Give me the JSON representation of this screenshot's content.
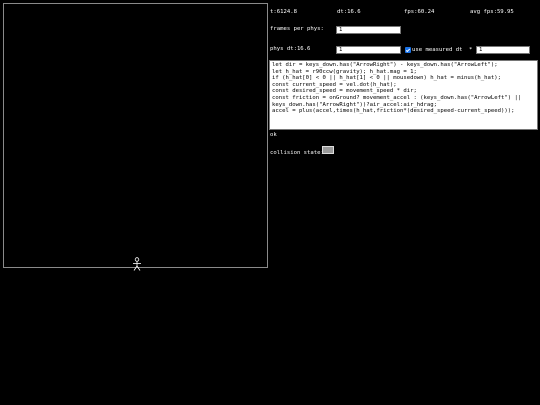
{
  "stats": {
    "time": "t:6124.8",
    "dt": "dt:16.6",
    "fps": "fps:60.24",
    "avg_fps": "avg fps:59.95"
  },
  "controls": {
    "frames_per_phys_label": "frames per phys:",
    "frames_per_phys_value": "1",
    "phys_dt_label": "phys dt:16.6",
    "phys_dt_value": "1",
    "use_measured_dt_label": "use measured dt",
    "use_measured_dt_checked": true,
    "multiplier_symbol": "*",
    "multiplier_value": "1"
  },
  "code": {
    "lines": [
      "let dir = keys_down.has(\"ArrowRight\") - keys_down.has(\"ArrowLeft\");",
      "let h_hat = r90ccw(gravity); h_hat.mag = 1;",
      "if (h_hat[0] < 0 || h_hat[1] < 0 || mousedown) h_hat = minus(h_hat);",
      "const current_speed = vel.dot(h_hat);",
      "const desired_speed = movement_speed * dir;",
      "const friction = onGround? movement_accel : (keys_down.has(\"ArrowLeft\") ||",
      "keys_down.has(\"ArrowRight\"))?air_accel:air_hdrag;",
      "accel = plus(accel,times(h_hat,friction*(desired_speed-current_speed)));"
    ]
  },
  "status": {
    "result": "ok",
    "collision_label": "collision state:"
  },
  "icons": {
    "player": "stick-figure-icon"
  }
}
